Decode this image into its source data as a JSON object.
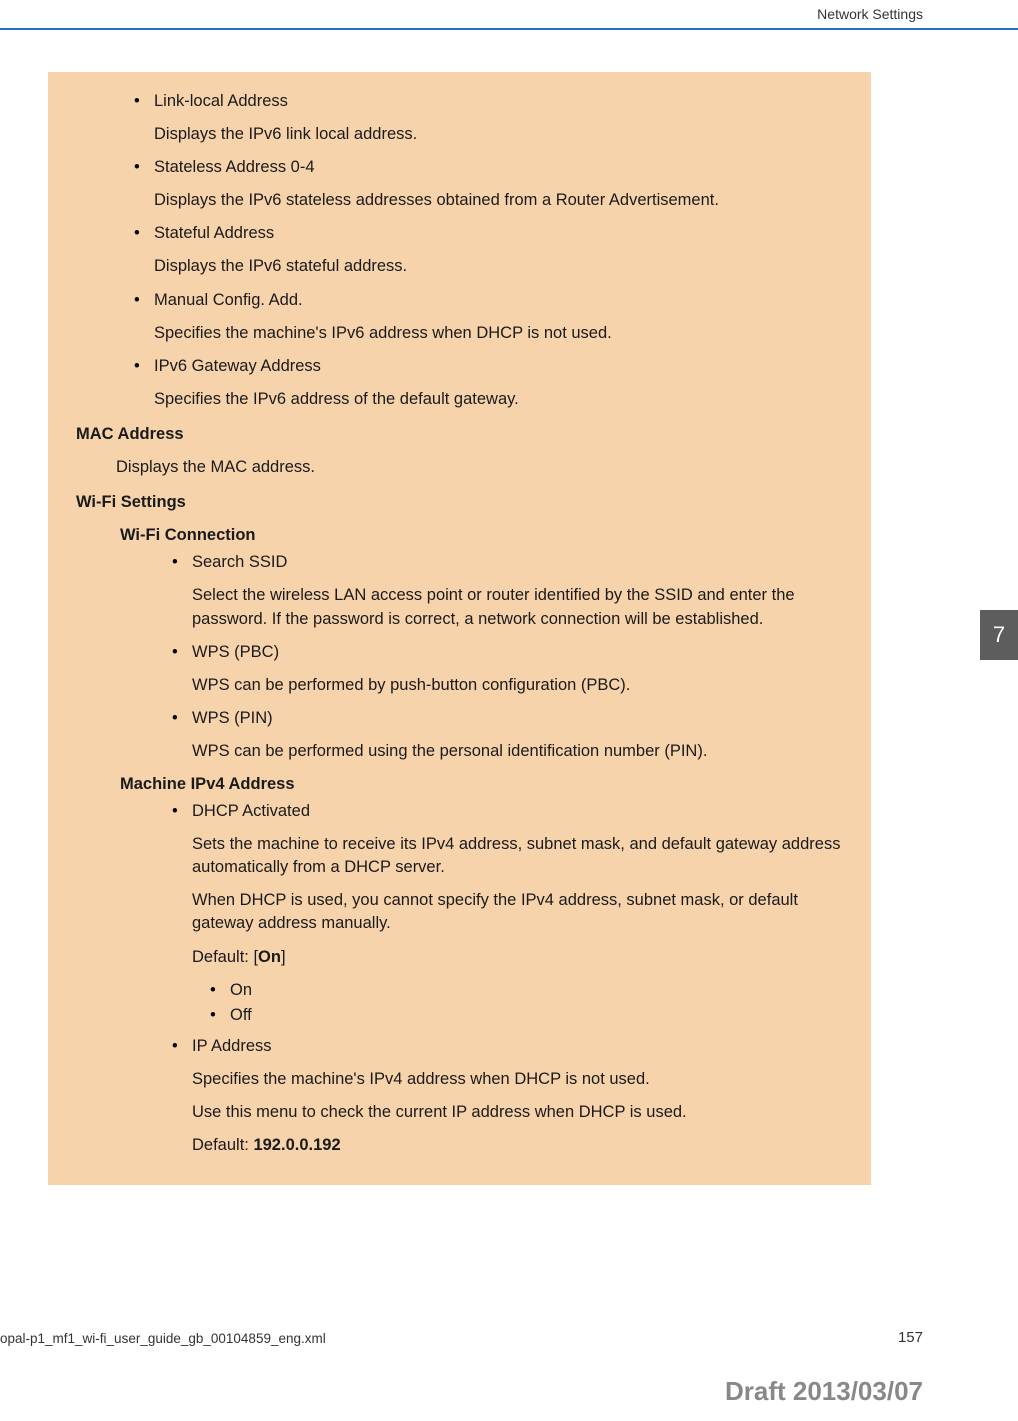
{
  "header": {
    "section": "Network Settings"
  },
  "tab": {
    "number": "7"
  },
  "items": {
    "linkLocal": {
      "title": "Link-local Address",
      "desc": "Displays the IPv6 link local address."
    },
    "stateless": {
      "title": "Stateless Address 0-4",
      "desc": "Displays the IPv6 stateless addresses obtained from a Router Advertisement."
    },
    "stateful": {
      "title": "Stateful Address",
      "desc": "Displays the IPv6 stateful address."
    },
    "manual": {
      "title": "Manual Config. Add.",
      "desc": "Specifies the machine's IPv6 address when DHCP is not used."
    },
    "gateway": {
      "title": "IPv6 Gateway Address",
      "desc": "Specifies the IPv6 address of the default gateway."
    }
  },
  "mac": {
    "title": "MAC Address",
    "desc": "Displays the MAC address."
  },
  "wifi": {
    "title": "Wi-Fi Settings",
    "connection": {
      "title": "Wi-Fi Connection",
      "ssid": {
        "title": "Search SSID",
        "desc": "Select the wireless LAN access point or router identified by the SSID and enter the password. If the password is correct, a network connection will be established."
      },
      "wpsPbc": {
        "title": "WPS (PBC)",
        "desc": "WPS can be performed by push-button configuration (PBC)."
      },
      "wpsPin": {
        "title": "WPS (PIN)",
        "desc": "WPS can be performed using the personal identification number (PIN)."
      }
    },
    "ipv4": {
      "title": "Machine IPv4 Address",
      "dhcp": {
        "title": "DHCP Activated",
        "desc1": "Sets the machine to receive its IPv4 address, subnet mask, and default gateway address automatically from a DHCP server.",
        "desc2": "When DHCP is used, you cannot specify the IPv4 address, subnet mask, or default gateway address manually.",
        "defaultPrefix": "Default: [",
        "defaultValue": "On",
        "defaultSuffix": "]",
        "opt1": "On",
        "opt2": "Off"
      },
      "ip": {
        "title": "IP Address",
        "desc1": "Specifies the machine's IPv4 address when DHCP is not used.",
        "desc2": "Use this menu to check the current IP address when DHCP is used.",
        "defaultPrefix": "Default: ",
        "defaultValue": "192.0.0.192"
      }
    }
  },
  "footer": {
    "filename": "opal-p1_mf1_wi-fi_user_guide_gb_00104859_eng.xml",
    "pageNumber": "157",
    "draft": "Draft 2013/03/07"
  }
}
